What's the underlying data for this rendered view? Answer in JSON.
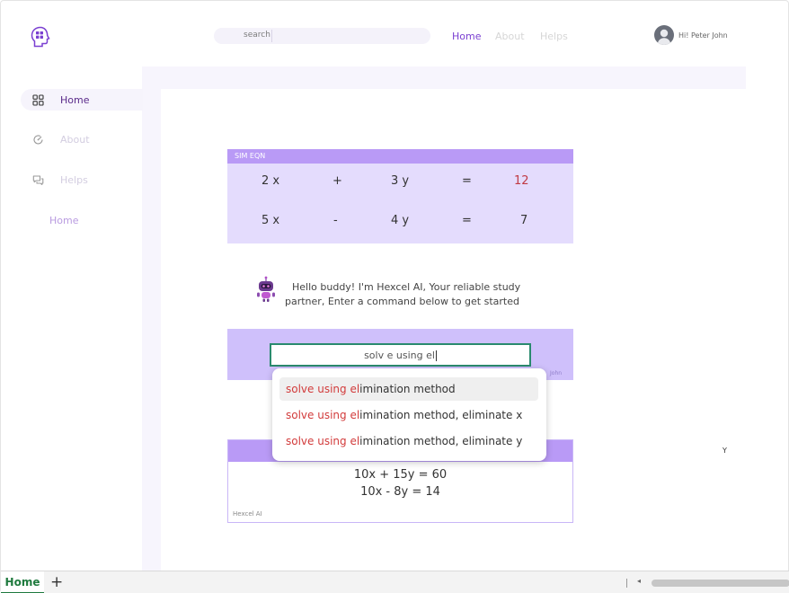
{
  "header": {
    "search_placeholder": "search",
    "nav": {
      "home": "Home",
      "about": "About",
      "helps": "Helps"
    },
    "greeting": "Hi! Peter John"
  },
  "sidebar": {
    "items": [
      {
        "label": "Home",
        "icon": "grid-icon"
      },
      {
        "label": "About",
        "icon": "gauge-icon"
      },
      {
        "label": "Helps",
        "icon": "chat-icon"
      }
    ],
    "extra_link": "Home"
  },
  "equation_card": {
    "title": "SIM EQN",
    "rows": [
      {
        "a": "2 x",
        "op": "+",
        "b": "3 y",
        "eq": "=",
        "c": "12"
      },
      {
        "a": "5 x",
        "op": "-",
        "b": "4 y",
        "eq": "=",
        "c": "7"
      }
    ]
  },
  "bot": {
    "message_line1": "Hello buddy! I'm Hexcel AI, Your reliable study",
    "message_line2": "partner, Enter a command below to get started"
  },
  "command": {
    "value": "solv e using el",
    "user_tag": "John"
  },
  "suggestions": [
    {
      "match": "solve using el",
      "rest": "imination method"
    },
    {
      "match": "solve using el",
      "rest": "imination method, eliminate x"
    },
    {
      "match": "solve using el",
      "rest": "imination method, eliminate y"
    }
  ],
  "result_card": {
    "lines": [
      "10x + 15y = 60",
      "10x - 8y = 14"
    ],
    "footer": "Hexcel AI"
  },
  "stray_label": "Y",
  "tabbar": {
    "active_tab": "Home",
    "add_label": "+",
    "scroll_left": "◂"
  },
  "colors": {
    "accent": "#7a3fd1",
    "card_light": "#e4dcfd",
    "card_header": "#b99af6",
    "input_border": "#2a8a6e",
    "match_red": "#d23b3b",
    "tab_green": "#1f7a3e"
  }
}
